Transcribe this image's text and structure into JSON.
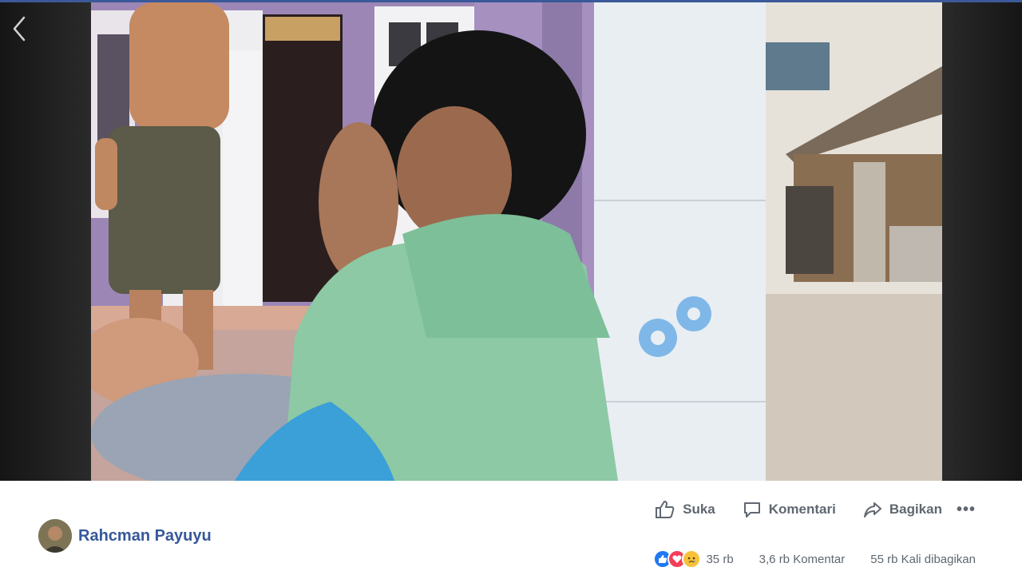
{
  "author": {
    "name": "Rahcman Payuyu"
  },
  "actions": {
    "like_label": "Suka",
    "comment_label": "Komentari",
    "share_label": "Bagikan",
    "more_label": "•••"
  },
  "stats": {
    "reaction_count": "35 rb",
    "comments": "3,6 rb Komentar",
    "shares": "55 rb Kali dibagikan"
  },
  "reactions": [
    "like-icon",
    "love-icon",
    "sad-icon"
  ],
  "colors": {
    "accent": "#365899",
    "top_bar": "#3b5998",
    "like": "#2078f4",
    "love": "#f33e58",
    "sad": "#f7c23b",
    "action_text": "#606770"
  }
}
